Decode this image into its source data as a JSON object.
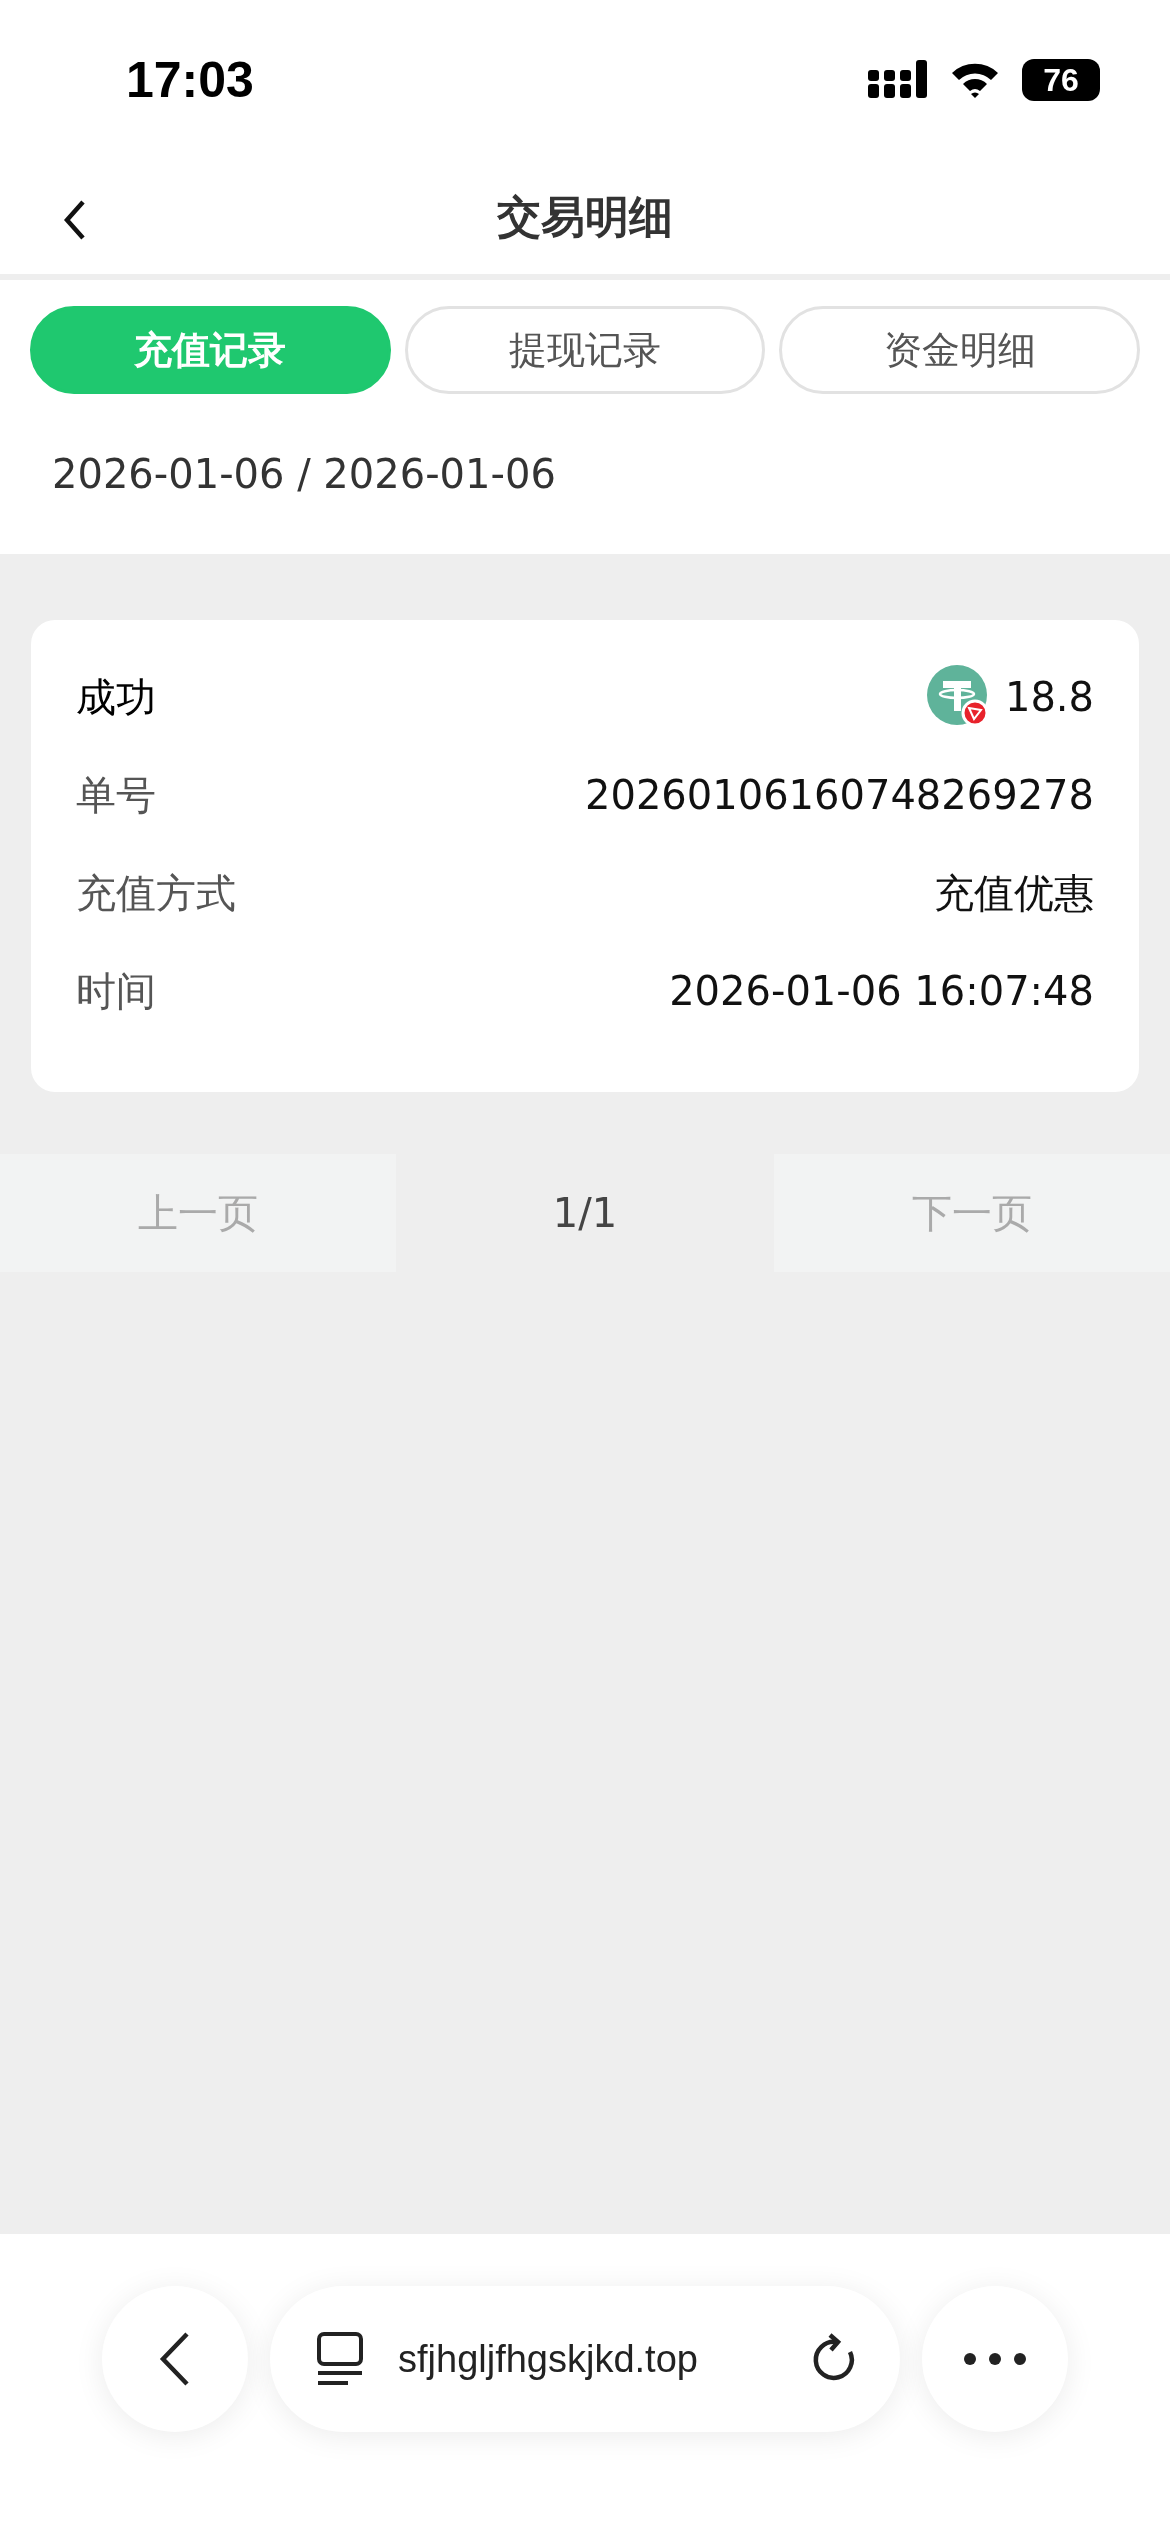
{
  "status_bar": {
    "time": "17:03",
    "battery": "76"
  },
  "nav": {
    "title": "交易明细"
  },
  "tabs": [
    {
      "label": "充值记录",
      "selected": true
    },
    {
      "label": "提现记录",
      "selected": false
    },
    {
      "label": "资金明细",
      "selected": false
    }
  ],
  "date_range": "2026-01-06 / 2026-01-06",
  "records": [
    {
      "rows": [
        {
          "kind": "amount",
          "label": "成功",
          "value": "18.8"
        },
        {
          "kind": "text",
          "label": "单号",
          "value": "20260106160748269278"
        },
        {
          "kind": "text",
          "label": "充值方式",
          "value": "充值优惠"
        },
        {
          "kind": "text",
          "label": "时间",
          "value": "2026-01-06 16:07:48"
        }
      ]
    }
  ],
  "pagination": {
    "prev": {
      "label": "上一页",
      "disabled": true
    },
    "page": "1/1",
    "next": {
      "label": "下一页",
      "disabled": true
    }
  },
  "browser_bar": {
    "url": "sfjhgljfhgskjkd.top"
  }
}
